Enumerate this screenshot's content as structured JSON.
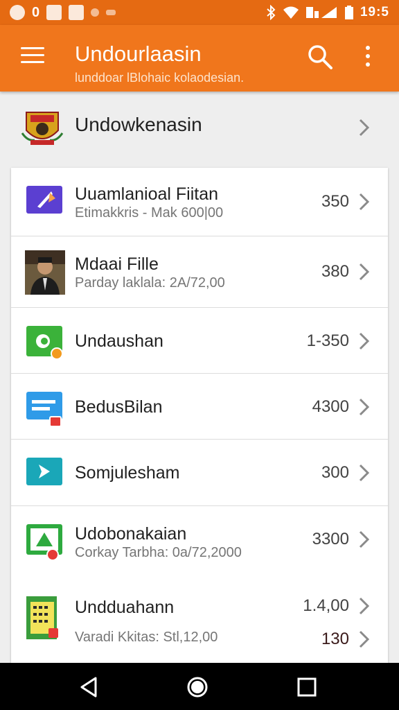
{
  "status_bar": {
    "notif_count": "0",
    "time": "19:5"
  },
  "app_bar": {
    "title": "Undourlaasin",
    "subtitle": "lunddoar lBlohaic kolaodesian.",
    "menu_icon": "hamburger-menu-icon",
    "search_icon": "search-icon",
    "more_icon": "more-vert-icon"
  },
  "header": {
    "label": "Undowkenasin",
    "icon": "crest-emblem-icon"
  },
  "items": [
    {
      "title": "Uuamlanioal Fiitan",
      "subtitle": "Etimakkris -  Mak 600|00",
      "value": "350",
      "icon": "purple-feather-app-icon"
    },
    {
      "title": "Mdaai Fille",
      "subtitle": "Parday lаklаlа: 2А/72,00",
      "value": "380",
      "icon": "person-photo-thumbnail"
    },
    {
      "title": "Undaushan",
      "subtitle": "",
      "value": "1-350",
      "icon": "green-app-icon"
    },
    {
      "title": "BedusBilan",
      "subtitle": "",
      "value": "4300",
      "icon": "blue-list-app-icon"
    },
    {
      "title": "Somjulesham",
      "subtitle": "",
      "value": "300",
      "icon": "teal-play-app-icon"
    },
    {
      "title": "Udobonakaian",
      "subtitle": "Corkay Tarbha: 0а/72,2000",
      "value": "3300",
      "icon": "green-warning-app-icon"
    },
    {
      "title": "Undduаhann",
      "subtitle": "Varadi Kkitas: Stl,12,00",
      "value": "1.4,00",
      "value2": "130",
      "icon": "spreadsheet-app-icon"
    }
  ],
  "colors": {
    "status_bar": "#e56a12",
    "app_bar": "#f0761c"
  }
}
